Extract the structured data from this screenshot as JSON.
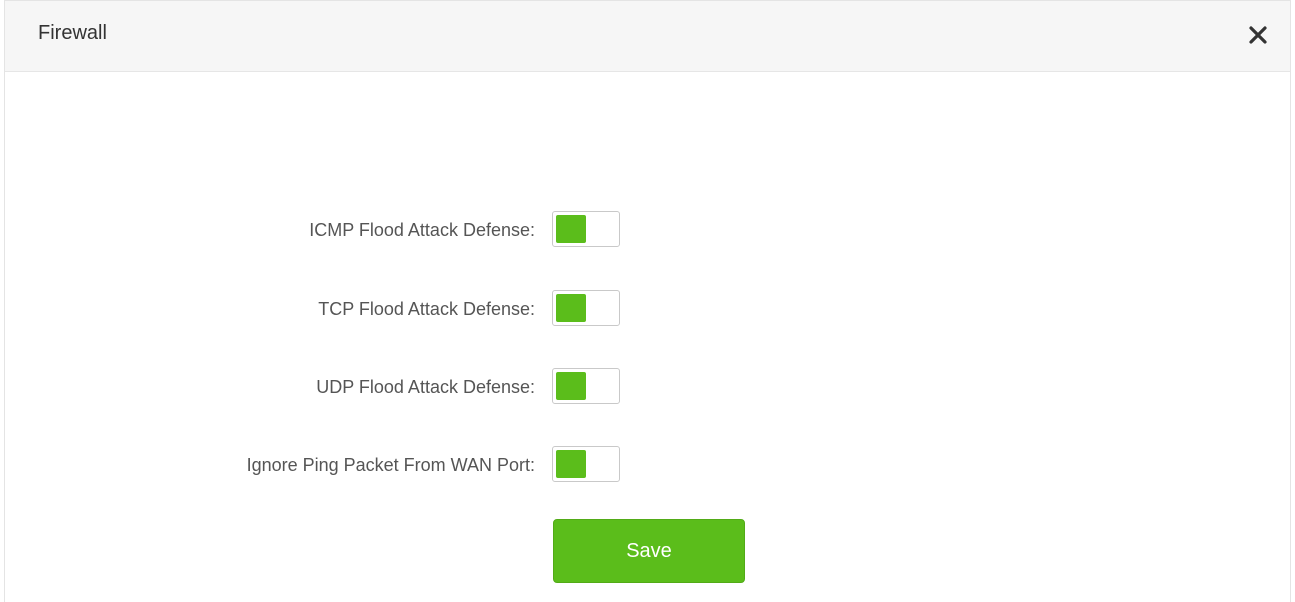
{
  "dialog": {
    "title": "Firewall",
    "close_icon": "close-icon"
  },
  "settings": [
    {
      "label": "ICMP Flood Attack Defense:",
      "enabled": true
    },
    {
      "label": "TCP Flood Attack Defense:",
      "enabled": true
    },
    {
      "label": "UDP Flood Attack Defense:",
      "enabled": true
    },
    {
      "label": "Ignore Ping Packet From WAN Port:",
      "enabled": true
    }
  ],
  "save_label": "Save",
  "colors": {
    "accent": "#5bbd1b",
    "header_bg": "#f6f6f6",
    "label_text": "#555555"
  }
}
